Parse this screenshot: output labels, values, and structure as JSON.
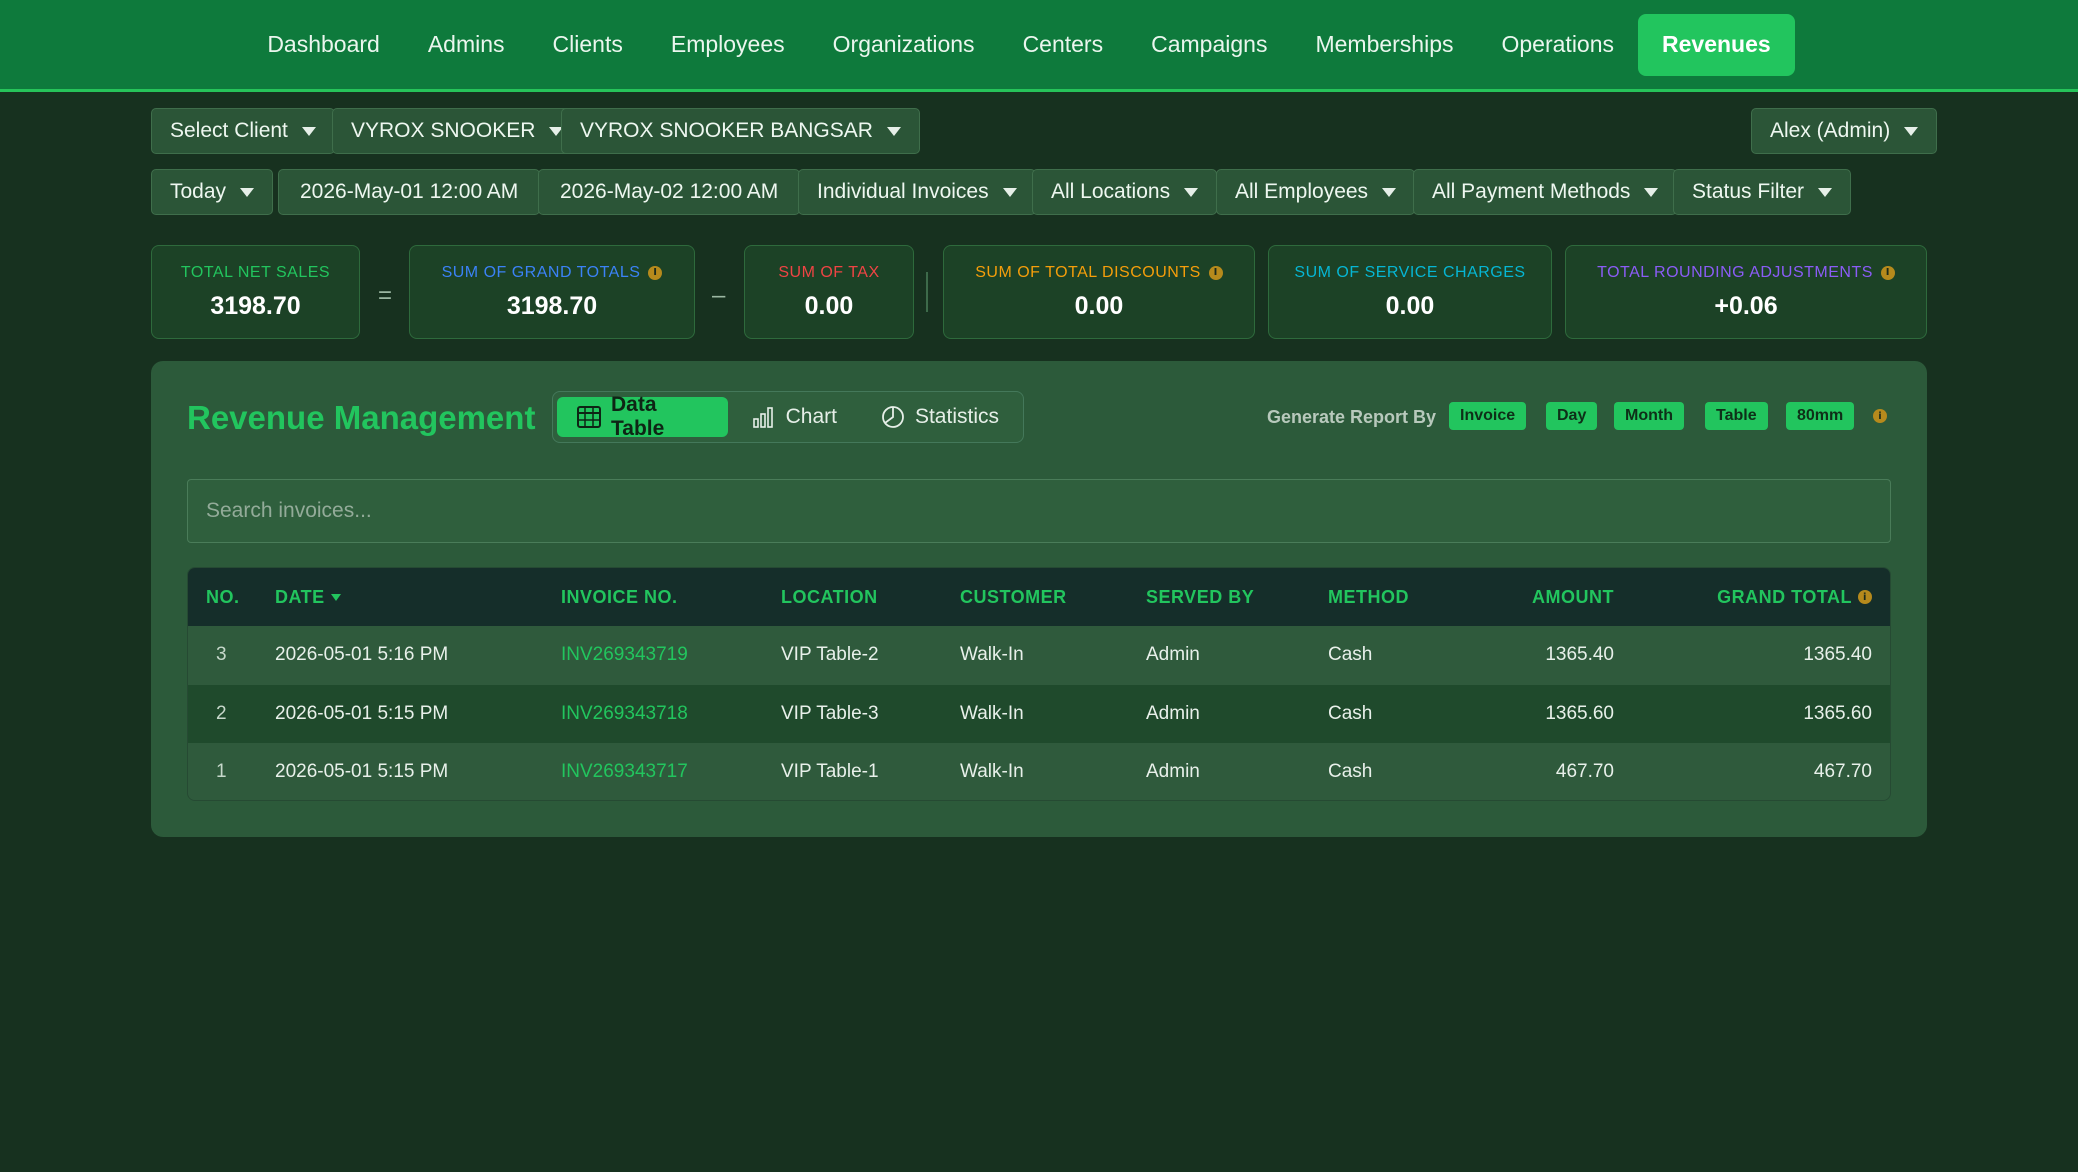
{
  "nav": {
    "items": [
      {
        "label": "Dashboard",
        "active": false
      },
      {
        "label": "Admins",
        "active": false
      },
      {
        "label": "Clients",
        "active": false
      },
      {
        "label": "Employees",
        "active": false
      },
      {
        "label": "Organizations",
        "active": false
      },
      {
        "label": "Centers",
        "active": false
      },
      {
        "label": "Campaigns",
        "active": false
      },
      {
        "label": "Memberships",
        "active": false
      },
      {
        "label": "Operations",
        "active": false
      },
      {
        "label": "Revenues",
        "active": true
      }
    ]
  },
  "filters": {
    "client": "Select Client",
    "organization": "VYROX SNOOKER",
    "center": "VYROX SNOOKER BANGSAR",
    "user": "Alex (Admin)",
    "range": "Today",
    "start_date": "2026-May-01 12:00 AM",
    "end_date": "2026-May-02 12:00 AM",
    "invoice_mode": "Individual Invoices",
    "locations": "All Locations",
    "employees": "All Employees",
    "payment_methods": "All Payment Methods",
    "status": "Status Filter"
  },
  "stats": {
    "net_sales": {
      "label": "TOTAL NET SALES",
      "value": "3198.70",
      "color": "#22c55e"
    },
    "grand_totals": {
      "label": "SUM OF GRAND TOTALS",
      "value": "3198.70",
      "color": "#3b82f6"
    },
    "tax": {
      "label": "SUM OF TAX",
      "value": "0.00",
      "color": "#ef4444"
    },
    "discounts": {
      "label": "SUM OF TOTAL DISCOUNTS",
      "value": "0.00",
      "color": "#f59e0b"
    },
    "service_charges": {
      "label": "SUM OF SERVICE CHARGES",
      "value": "0.00",
      "color": "#06b6d4"
    },
    "rounding": {
      "label": "TOTAL ROUNDING ADJUSTMENTS",
      "value": "+0.06",
      "color": "#8b5cf6"
    },
    "op_equals": "=",
    "op_minus": "–"
  },
  "panel": {
    "title": "Revenue Management",
    "tabs": {
      "data_table": "Data Table",
      "chart": "Chart",
      "statistics": "Statistics"
    },
    "generate_label": "Generate Report By",
    "generate_buttons": [
      "Invoice",
      "Day",
      "Month",
      "Table",
      "80mm"
    ],
    "search_placeholder": "Search invoices..."
  },
  "table": {
    "headers": {
      "no": "NO.",
      "date": "DATE",
      "invoice": "INVOICE NO.",
      "location": "LOCATION",
      "customer": "CUSTOMER",
      "served_by": "SERVED BY",
      "method": "METHOD",
      "amount": "AMOUNT",
      "grand_total": "GRAND TOTAL"
    },
    "rows": [
      {
        "no": "3",
        "date": "2026-05-01 5:16 PM",
        "invoice": "INV269343719",
        "location": "VIP Table-2",
        "customer": "Walk-In",
        "served_by": "Admin",
        "method": "Cash",
        "amount": "1365.40",
        "grand_total": "1365.40"
      },
      {
        "no": "2",
        "date": "2026-05-01 5:15 PM",
        "invoice": "INV269343718",
        "location": "VIP Table-3",
        "customer": "Walk-In",
        "served_by": "Admin",
        "method": "Cash",
        "amount": "1365.60",
        "grand_total": "1365.60"
      },
      {
        "no": "1",
        "date": "2026-05-01 5:15 PM",
        "invoice": "INV269343717",
        "location": "VIP Table-1",
        "customer": "Walk-In",
        "served_by": "Admin",
        "method": "Cash",
        "amount": "467.70",
        "grand_total": "467.70"
      }
    ]
  }
}
